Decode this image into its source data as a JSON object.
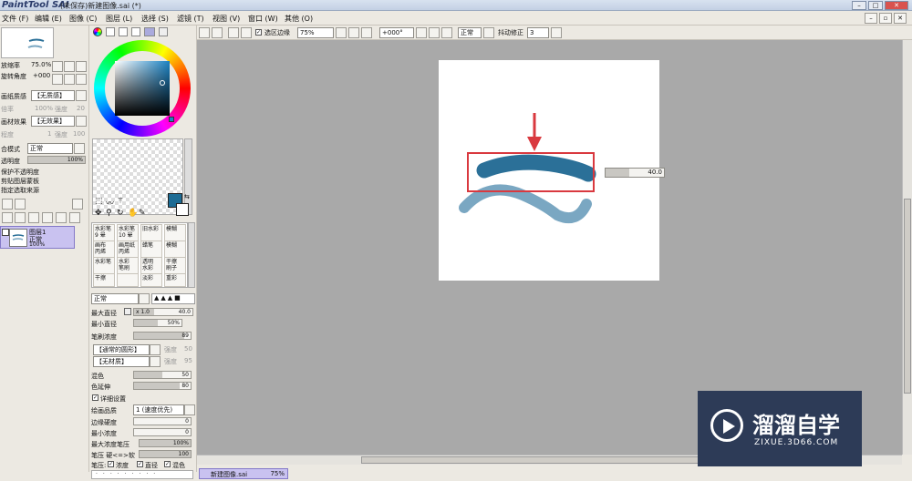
{
  "app": {
    "logo": "PaintTool SAI",
    "title": "(未保存)新建图像.sai (*)"
  },
  "menu": [
    "文件 (F)",
    "编辑 (E)",
    "图像 (C)",
    "图层 (L)",
    "选择 (S)",
    "滤镜 (T)",
    "视图 (V)",
    "窗口 (W)",
    "其他 (O)"
  ],
  "toolbar": {
    "selection_edge": "选区边缘",
    "zoom": "75%",
    "rotation": "+000°",
    "blend": "正常",
    "stabilizer_label": "抖动修正",
    "stabilizer": "3"
  },
  "navigator": {
    "zoom_label": "放缩率",
    "zoom": "75.0%",
    "angle_label": "旋转角度",
    "angle": "+000"
  },
  "paper": {
    "texture_label": "画纸质感",
    "texture": "【无质感】",
    "texture_scale_label": "倍率",
    "texture_scale": "100%",
    "texture_strength_label": "强度",
    "texture_strength": "20",
    "effect_label": "画材效果",
    "effect": "【无效果】",
    "effect_level_label": "程度",
    "effect_level": "1",
    "effect_strength_label": "强度",
    "effect_strength": "100"
  },
  "layer": {
    "blend_label": "合模式",
    "blend": "正常",
    "opacity_label": "透明度",
    "opacity": "100%",
    "preserve": "保护不透明度",
    "clip": "剪贴图层蒙板",
    "select_source": "指定选取来源",
    "name": "图层1",
    "mode": "正常",
    "percent": "100%"
  },
  "brushes": [
    {
      "name": "水彩笔",
      "sub": "9 晕"
    },
    {
      "name": "水彩笔",
      "sub": "10 晕"
    },
    {
      "name": "旧水彩",
      "sub": ""
    },
    {
      "name": "模糊",
      "sub": ""
    },
    {
      "name": "画布",
      "sub": "丙烯"
    },
    {
      "name": "画用纸",
      "sub": "丙烯"
    },
    {
      "name": "蜡笔",
      "sub": ""
    },
    {
      "name": "模糊",
      "sub": ""
    },
    {
      "name": "水彩笔",
      "sub": ""
    },
    {
      "name": "水彩",
      "sub": "笔刷"
    },
    {
      "name": "透明",
      "sub": "水彩"
    },
    {
      "name": "干擦",
      "sub": "刷子"
    },
    {
      "name": "干擦",
      "sub": ""
    },
    {
      "name": "",
      "sub": ""
    },
    {
      "name": "淡彩",
      "sub": ""
    },
    {
      "name": "重彩",
      "sub": ""
    }
  ],
  "brush_settings": {
    "mode": "正常",
    "max_size_label": "最大直径",
    "max_size_mult": "x 1.0",
    "max_size": "40.0",
    "min_size_label": "最小直径",
    "min_size": "50%",
    "density_label": "笔刷浓度",
    "density": "89",
    "shape": "【通常的圆形】",
    "shape_strength_label": "强度",
    "shape_strength": "50",
    "texture": "【无材质】",
    "texture_strength_label": "强度",
    "texture_strength": "95",
    "blend_label": "混色",
    "blend": "50",
    "dilution_label": "色延伸",
    "dilution": "80",
    "detail_label": "详细设置",
    "quality_label": "绘画品质",
    "quality": "1 (速度优先)",
    "edge_hardness_label": "边缘硬度",
    "edge_hardness": "0",
    "min_density_label": "最小浓度",
    "min_density": "0",
    "max_pressure_label": "最大浓度笔压",
    "max_pressure": "100%",
    "pressure_label": "笔压 硬<=>软",
    "pressure": "100",
    "pressure_opts_label": "笔压:",
    "pressure_opt1": "浓度",
    "pressure_opt2": "直径",
    "pressure_opt3": "混色"
  },
  "annotation": {
    "size_value": "40.0"
  },
  "status": {
    "tab": "新建图像.sai",
    "zoom": "75%"
  },
  "watermark": {
    "brand": "溜溜自学",
    "url": "ZIXUE.3D66.COM"
  },
  "colors": {
    "stroke_dark": "#2b7098",
    "stroke_light": "#7aa7c2",
    "arrow": "#d9393f",
    "fg_color": "#1c6b94",
    "layer_selected": "#c9c2f0"
  }
}
